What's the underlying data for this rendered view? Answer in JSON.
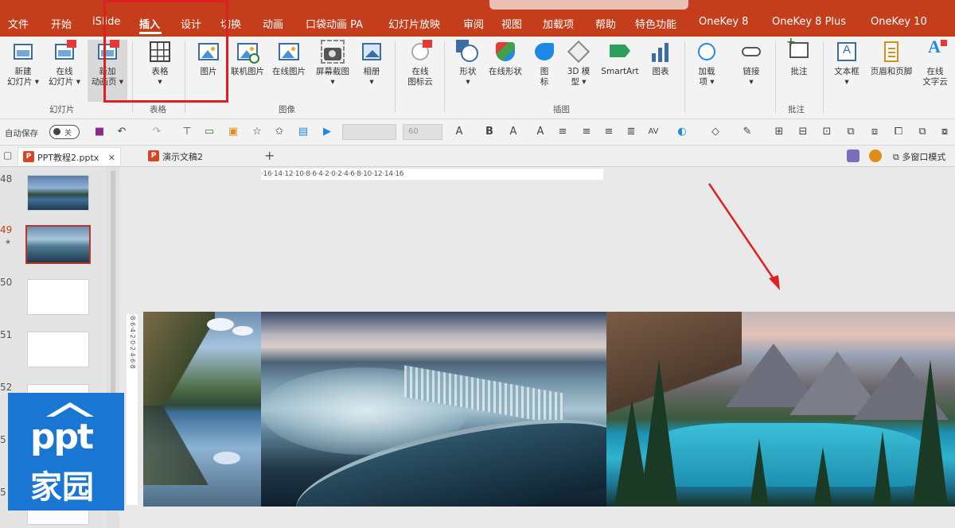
{
  "menubar": {
    "items": [
      "文件",
      "开始",
      "iSlide",
      "插入",
      "设计",
      "切换",
      "动画",
      "口袋动画 PA",
      "幻灯片放映",
      "审阅",
      "视图",
      "加载项",
      "帮助",
      "特色功能",
      "OneKey 8",
      "OneKey 8 Plus",
      "OneKey 10"
    ],
    "active": "插入",
    "accent": "#c43e1c"
  },
  "ribbon": {
    "buttons": [
      {
        "label": "新建\n幻灯片 ▾",
        "icon": "new-slide-icon"
      },
      {
        "label": "在线\n幻灯片 ▾",
        "icon": "online-slide-icon"
      },
      {
        "label": "新加\n动画页 ▾",
        "icon": "new-animation-page-icon"
      },
      {
        "label": "表格\n▾",
        "icon": "table-icon"
      },
      {
        "label": "图片",
        "icon": "picture-icon"
      },
      {
        "label": "联机图片",
        "icon": "online-picture-icon"
      },
      {
        "label": "在线图片",
        "icon": "web-picture-icon"
      },
      {
        "label": "屏幕截图\n▾",
        "icon": "screenshot-icon"
      },
      {
        "label": "相册\n▾",
        "icon": "album-icon"
      },
      {
        "label": "在线\n图标云",
        "icon": "icon-cloud-icon"
      },
      {
        "label": "形状\n▾",
        "icon": "shapes-icon"
      },
      {
        "label": "在线形状",
        "icon": "online-shapes-icon"
      },
      {
        "label": "图\n标",
        "icon": "icons-icon"
      },
      {
        "label": "3D 模\n型 ▾",
        "icon": "3d-model-icon"
      },
      {
        "label": "SmartArt",
        "icon": "smartart-icon"
      },
      {
        "label": "图表",
        "icon": "chart-icon"
      },
      {
        "label": "加载\n项 ▾",
        "icon": "addins-icon"
      },
      {
        "label": "链接\n▾",
        "icon": "link-icon"
      },
      {
        "label": "批注",
        "icon": "comment-icon"
      },
      {
        "label": "文本框\n▾",
        "icon": "textbox-icon"
      },
      {
        "label": "页眉和页脚",
        "icon": "header-footer-icon"
      },
      {
        "label": "在线\n文字云",
        "icon": "word-cloud-icon"
      }
    ],
    "groups": [
      "幻灯片",
      "表格",
      "图像",
      "插图",
      "批注"
    ]
  },
  "qat": {
    "autosave_label": "自动保存",
    "autosave_state": "关",
    "font_placeholder": "",
    "size_placeholder": "60"
  },
  "tabs": [
    {
      "label": "PPT教程2.pptx",
      "active": true
    },
    {
      "label": "演示文稿2",
      "active": false
    }
  ],
  "tab_right": {
    "multi_window": "多窗口模式"
  },
  "thumbnails": {
    "numbers": [
      "48",
      "49",
      "50",
      "51",
      "52",
      "5",
      "5"
    ],
    "current": "49"
  },
  "ruler": {
    "horizontal": "·16·14·12·10·8·6·4·2·0·2·4·6·8·10·12·14·16",
    "vertical": "·8·6·4·2·0·2·4·6·8"
  },
  "logo": {
    "line1": "ppt",
    "line2": "家园"
  }
}
